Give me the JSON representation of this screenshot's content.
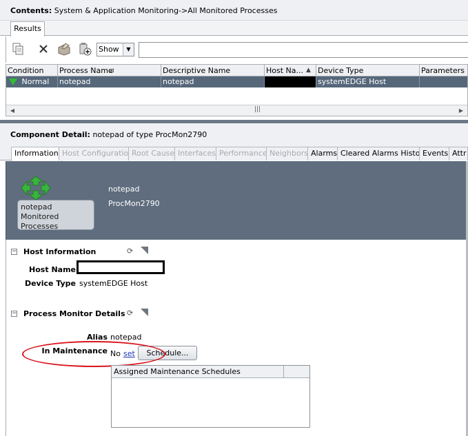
{
  "contents": {
    "label": "Contents:",
    "path": "System & Application Monitoring->All Monitored Processes"
  },
  "top_tabs": [
    {
      "label": "Results"
    }
  ],
  "toolbar": {
    "show_label": "Show"
  },
  "grid": {
    "columns": [
      "Condition",
      "Process Name",
      "Descriptive Name",
      "Host Na...",
      "Device Type",
      "Parameters"
    ],
    "rows": [
      {
        "condition": "Normal",
        "process_name": "notepad",
        "descriptive_name": "notepad",
        "host_name": "",
        "device_type": "systemEDGE Host",
        "parameters": ""
      }
    ]
  },
  "component_detail": {
    "label": "Component Detail:",
    "subtitle": "notepad of type ProcMon2790"
  },
  "detail_tabs": [
    {
      "label": "Information",
      "state": "active"
    },
    {
      "label": "Host Configuration",
      "state": "disabled"
    },
    {
      "label": "Root Cause",
      "state": "disabled"
    },
    {
      "label": "Interfaces",
      "state": "disabled"
    },
    {
      "label": "Performance",
      "state": "disabled"
    },
    {
      "label": "Neighbors",
      "state": "disabled"
    },
    {
      "label": "Alarms",
      "state": "enabled"
    },
    {
      "label": "Cleared Alarms History",
      "state": "enabled"
    },
    {
      "label": "Events",
      "state": "enabled"
    },
    {
      "label": "Attr",
      "state": "enabled"
    }
  ],
  "banner": {
    "card_line1": "notepad",
    "card_line2": "Monitored Processes",
    "name": "notepad",
    "type": "ProcMon2790"
  },
  "host_information": {
    "title": "Host Information",
    "host_name_label": "Host Name",
    "device_type_label": "Device Type",
    "device_type_value": "systemEDGE Host"
  },
  "process_monitor": {
    "title": "Process Monitor Details",
    "alias_label": "Alias",
    "alias_value": "notepad",
    "maintenance_label": "In Maintenance",
    "maintenance_value": "No",
    "set_link": "set",
    "schedule_button": "Schedule...",
    "schedules_header": "Assigned Maintenance Schedules"
  },
  "colors": {
    "selected_row": "#56677a",
    "banner": "#5f6d7e",
    "annotation_circle": "#d8121b",
    "normal_status": "#2fbf32"
  }
}
